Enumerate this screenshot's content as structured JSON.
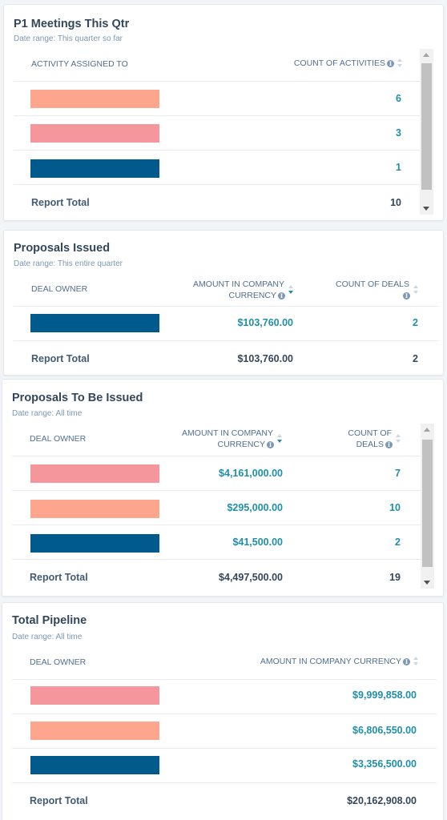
{
  "colors": {
    "bar_salmon": "#fea58e",
    "bar_pink": "#f5959c",
    "bar_navy": "#005a8c",
    "link": "#1f8fa8",
    "text_dark": "#33475b"
  },
  "reports": [
    {
      "title": "P1 Meetings This Qtr",
      "date_range": "Date range: This quarter so far",
      "columns": [
        "ACTIVITY ASSIGNED TO",
        "COUNT OF ACTIVITIES"
      ],
      "rows": [
        {
          "owner_color": "salmon",
          "count": "6"
        },
        {
          "owner_color": "pink",
          "count": "3"
        },
        {
          "owner_color": "navy",
          "count": "1"
        }
      ],
      "total_label": "Report Total",
      "total_count": "10"
    },
    {
      "title": "Proposals Issued",
      "date_range": "Date range: This entire quarter",
      "columns": [
        "DEAL OWNER",
        "AMOUNT IN COMPANY",
        "CURRENCY",
        "COUNT OF DEALS"
      ],
      "rows": [
        {
          "owner_color": "navy",
          "amount": "$103,760.00",
          "count": "2"
        }
      ],
      "total_label": "Report Total",
      "total_amount": "$103,760.00",
      "total_count": "2"
    },
    {
      "title": "Proposals To Be Issued",
      "date_range": "Date range: All time",
      "columns": [
        "DEAL OWNER",
        "AMOUNT IN COMPANY",
        "CURRENCY",
        "COUNT OF",
        "DEALS"
      ],
      "rows": [
        {
          "owner_color": "pink",
          "amount": "$4,161,000.00",
          "count": "7"
        },
        {
          "owner_color": "salmon",
          "amount": "$295,000.00",
          "count": "10"
        },
        {
          "owner_color": "navy",
          "amount": "$41,500.00",
          "count": "2"
        }
      ],
      "total_label": "Report Total",
      "total_amount": "$4,497,500.00",
      "total_count": "19"
    },
    {
      "title": "Total Pipeline",
      "date_range": "Date range: All time",
      "columns": [
        "DEAL OWNER",
        "AMOUNT IN COMPANY CURRENCY"
      ],
      "rows": [
        {
          "owner_color": "pink",
          "amount": "$9,999,858.00"
        },
        {
          "owner_color": "salmon",
          "amount": "$6,806,550.00"
        },
        {
          "owner_color": "navy",
          "amount": "$3,356,500.00"
        }
      ],
      "total_label": "Report Total",
      "total_amount": "$20,162,908.00"
    }
  ],
  "icons": {
    "info": "i"
  }
}
